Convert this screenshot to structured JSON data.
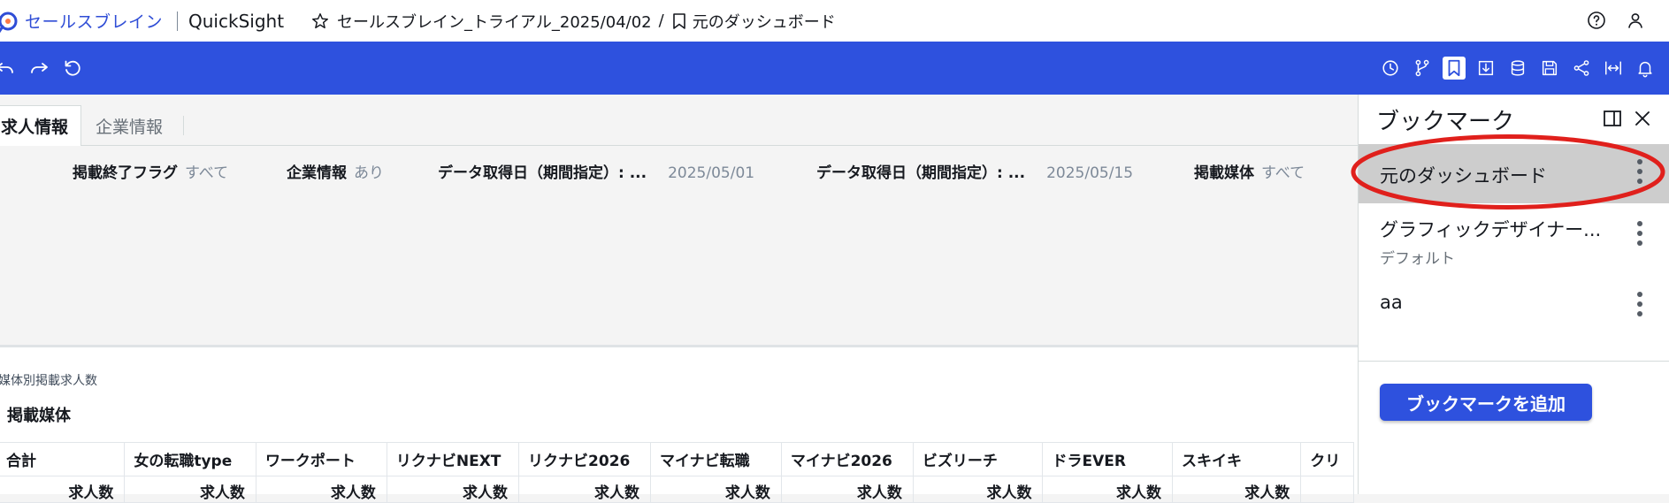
{
  "topbar": {
    "brand_name": "セールスブレイン",
    "product_name": "QuickSight",
    "analysis_name": "セールスブレイン_トライアル_2025/04/02",
    "separator": "/",
    "bookmark_name": "元のダッシュボード"
  },
  "tabs": [
    {
      "label": "求人情報",
      "active": true
    },
    {
      "label": "企業情報",
      "active": false
    }
  ],
  "controls": [
    {
      "label": "掲載終了フラグ",
      "value": "すべて"
    },
    {
      "label": "企業情報",
      "value": "あり"
    },
    {
      "label": "データ取得日（期間指定）: ...",
      "value": "2025/05/01"
    },
    {
      "label": "データ取得日（期間指定）: ...",
      "value": "2025/05/15"
    },
    {
      "label": "掲載媒体",
      "value": "すべて"
    }
  ],
  "visual": {
    "subtitle": "媒体別掲載求人数",
    "title": "掲載媒体",
    "columns": [
      "合計",
      "女の転職type",
      "ワークポート",
      "リクナビNEXT",
      "リクナビ2026",
      "マイナビ転職",
      "マイナビ2026",
      "ビズリーチ",
      "ドラEVER",
      "スキイキ",
      "クリ"
    ],
    "row_labels": [
      "求人数",
      "求人数",
      "求人数",
      "求人数",
      "求人数",
      "求人数",
      "求人数",
      "求人数",
      "求人数",
      "求人数"
    ]
  },
  "sidebar": {
    "title": "ブックマーク",
    "items": [
      {
        "name": "元のダッシュボード",
        "sub": "",
        "selected": true
      },
      {
        "name": "グラフィックデザイナー...",
        "sub": "デフォルト",
        "selected": false
      },
      {
        "name": "aa",
        "sub": "",
        "selected": false
      }
    ],
    "add_button": "ブックマークを追加"
  },
  "colors": {
    "toolbar": "#2e51de",
    "annotation": "#e0201c",
    "selected_item": "#cdcdcd"
  }
}
